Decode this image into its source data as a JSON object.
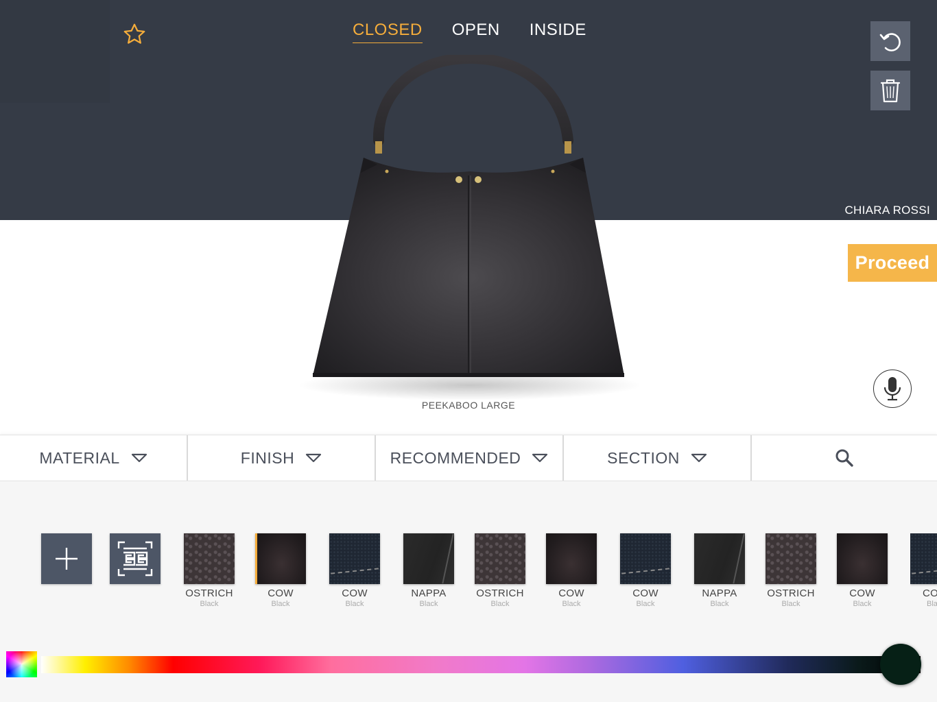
{
  "header": {
    "view_tabs": [
      {
        "label": "CLOSED",
        "active": true
      },
      {
        "label": "OPEN",
        "active": false
      },
      {
        "label": "INSIDE",
        "active": false
      }
    ],
    "client_name": "CHIARA ROSSI",
    "favorite_icon": "star-outline-icon",
    "undo_icon": "undo-icon",
    "trash_icon": "trash-icon",
    "accent_color": "#f5ad3b",
    "header_bg_color": "#353b46"
  },
  "product": {
    "name": "PEEKABOO LARGE"
  },
  "actions": {
    "proceed_label": "Proceed",
    "mic_icon": "microphone-icon"
  },
  "filters": [
    {
      "label": "MATERIAL"
    },
    {
      "label": "FINISH"
    },
    {
      "label": "RECOMMENDED"
    },
    {
      "label": "SECTION"
    }
  ],
  "search_icon": "search-icon",
  "swatch_tools": {
    "add_icon": "plus-icon",
    "scan_icon": "scan-pattern-icon"
  },
  "swatches": [
    {
      "name": "OSTRICH",
      "color": "Black"
    },
    {
      "name": "COW",
      "color": "Black"
    },
    {
      "name": "COW",
      "color": "Black"
    },
    {
      "name": "NAPPA",
      "color": "Black"
    },
    {
      "name": "OSTRICH",
      "color": "Black"
    },
    {
      "name": "COW",
      "color": "Black"
    },
    {
      "name": "COW",
      "color": "Black"
    },
    {
      "name": "NAPPA",
      "color": "Black"
    },
    {
      "name": "OSTRICH",
      "color": "Black"
    },
    {
      "name": "COW",
      "color": "Black"
    },
    {
      "name": "COW",
      "color": "Black"
    }
  ],
  "color_picker": {
    "selected_color": "#062016"
  }
}
